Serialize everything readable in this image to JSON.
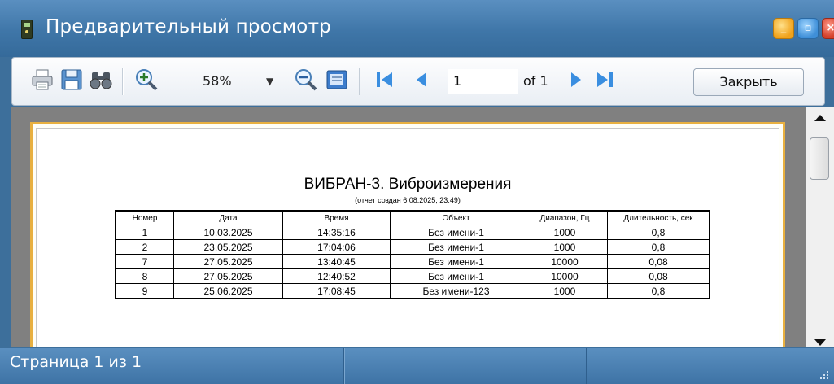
{
  "window": {
    "title": "Предварительный просмотр"
  },
  "toolbar": {
    "icons": [
      "printer-icon",
      "save-icon",
      "find-icon",
      "zoom-in-icon",
      "zoom-out-icon",
      "page-width-icon",
      "first-page-icon",
      "prev-page-icon",
      "next-page-icon",
      "last-page-icon"
    ],
    "zoom_value": "58%",
    "page_value": "1",
    "page_of": "of 1",
    "close_label": "Закрыть"
  },
  "report": {
    "title": "ВИБРАН-3. Виброизмерения",
    "subtitle": "(отчет создан 6.08.2025, 23:49)",
    "columns": [
      "Номер",
      "Дата",
      "Время",
      "Объект",
      "Диапазон, Гц",
      "Длительность, сек"
    ],
    "rows": [
      [
        "1",
        "10.03.2025",
        "14:35:16",
        "Без имени-1",
        "1000",
        "0,8"
      ],
      [
        "2",
        "23.05.2025",
        "17:04:06",
        "Без имени-1",
        "1000",
        "0,8"
      ],
      [
        "7",
        "27.05.2025",
        "13:40:45",
        "Без имени-1",
        "10000",
        "0,08"
      ],
      [
        "8",
        "27.05.2025",
        "12:40:52",
        "Без имени-1",
        "10000",
        "0,08"
      ],
      [
        "9",
        "25.06.2025",
        "17:08:45",
        "Без имени-123",
        "1000",
        "0,8"
      ]
    ]
  },
  "status": {
    "text": "Страница 1 из 1"
  },
  "colors": {
    "titlebar": "#3f76a8",
    "page_border": "#e8b040",
    "viewport_bg": "#808080"
  }
}
